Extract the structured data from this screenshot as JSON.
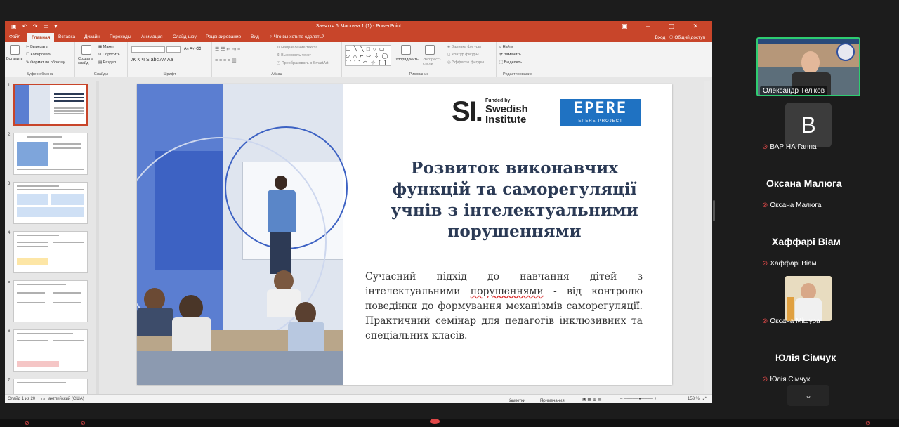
{
  "app": {
    "window_title": "Заняття 6. Частина 1 (1) - PowerPoint",
    "tell_me": "Что вы хотите сделать?",
    "login": "Вход",
    "share": "Общий доступ"
  },
  "tabs": [
    {
      "label": "Файл"
    },
    {
      "label": "Главная"
    },
    {
      "label": "Вставка"
    },
    {
      "label": "Дизайн"
    },
    {
      "label": "Переходы"
    },
    {
      "label": "Анимация"
    },
    {
      "label": "Слайд-шоу"
    },
    {
      "label": "Рецензирование"
    },
    {
      "label": "Вид"
    }
  ],
  "ribbon": {
    "clipboard": {
      "paste": "Вставить",
      "cut": "Вырезать",
      "copy": "Копировать",
      "format_painter": "Формат по образцу",
      "label": "Буфер обмена"
    },
    "slides": {
      "new_slide": "Создать слайд",
      "layout": "Макет",
      "reset": "Сбросить",
      "section": "Раздел",
      "label": "Слайды"
    },
    "font": {
      "label": "Шрифт",
      "buttons": "Ж К Ч S abc AV Aa"
    },
    "paragraph": {
      "label": "Абзац",
      "text_direction": "Направление текста",
      "align_text": "Выровнять текст",
      "convert_smartart": "Преобразовать в SmartArt"
    },
    "drawing": {
      "arrange": "Упорядочить",
      "quick_styles": "Экспресс-стили",
      "fill": "Заливка фигуры",
      "outline": "Контур фигуры",
      "effects": "Эффекты фигуры",
      "label": "Рисование"
    },
    "editing": {
      "find": "Найти",
      "replace": "Заменить",
      "select": "Выделить",
      "label": "Редактирование"
    }
  },
  "thumbnails": [
    "1",
    "2",
    "3",
    "4",
    "5",
    "6",
    "7"
  ],
  "slide": {
    "funded_by": "Funded by",
    "si_letters": "SI.",
    "si_name": "Swedish Institute",
    "epere_logo": "EPERE",
    "epere_caption": "EPERE-PROJECT",
    "title_lines": [
      "Розвиток виконавчих",
      "функцій та саморегуляції",
      "учнів з інтелектуальними",
      "порушеннями"
    ],
    "body_before": "Сучасний підхід до навчання дітей з інтелектуальними ",
    "body_underlined": "порушеннями",
    "body_after": " - від контролю поведінки до формування механізмів саморегуляції. Практичний семінар для педагогів інклюзивних та спеціальних класів."
  },
  "statusbar": {
    "slide_count": "Слайд 1 из 20",
    "language": "английский (США)",
    "notes": "Заметки",
    "comments": "Примечания",
    "zoom": "153 %"
  },
  "participants": [
    {
      "name": "Олександр Теліков",
      "type": "video"
    },
    {
      "name": "ВАРІНА Ганна",
      "avatar": "B",
      "type": "avatar"
    },
    {
      "name": "Оксана Малюга",
      "display": "Оксана Малюга",
      "type": "name"
    },
    {
      "name": "Хаффарі Віам",
      "display": "Хаффарі Віам",
      "type": "name"
    },
    {
      "name": "Оксана Мішура",
      "type": "video"
    },
    {
      "name": "Юлія Сімчук",
      "display": "Юлія Сімчук",
      "type": "name"
    }
  ],
  "colors": {
    "ppt_accent": "#c8452a",
    "slide_blue": "#3d62c3",
    "title_navy": "#2b3a55",
    "epere_blue": "#1f72c2"
  }
}
